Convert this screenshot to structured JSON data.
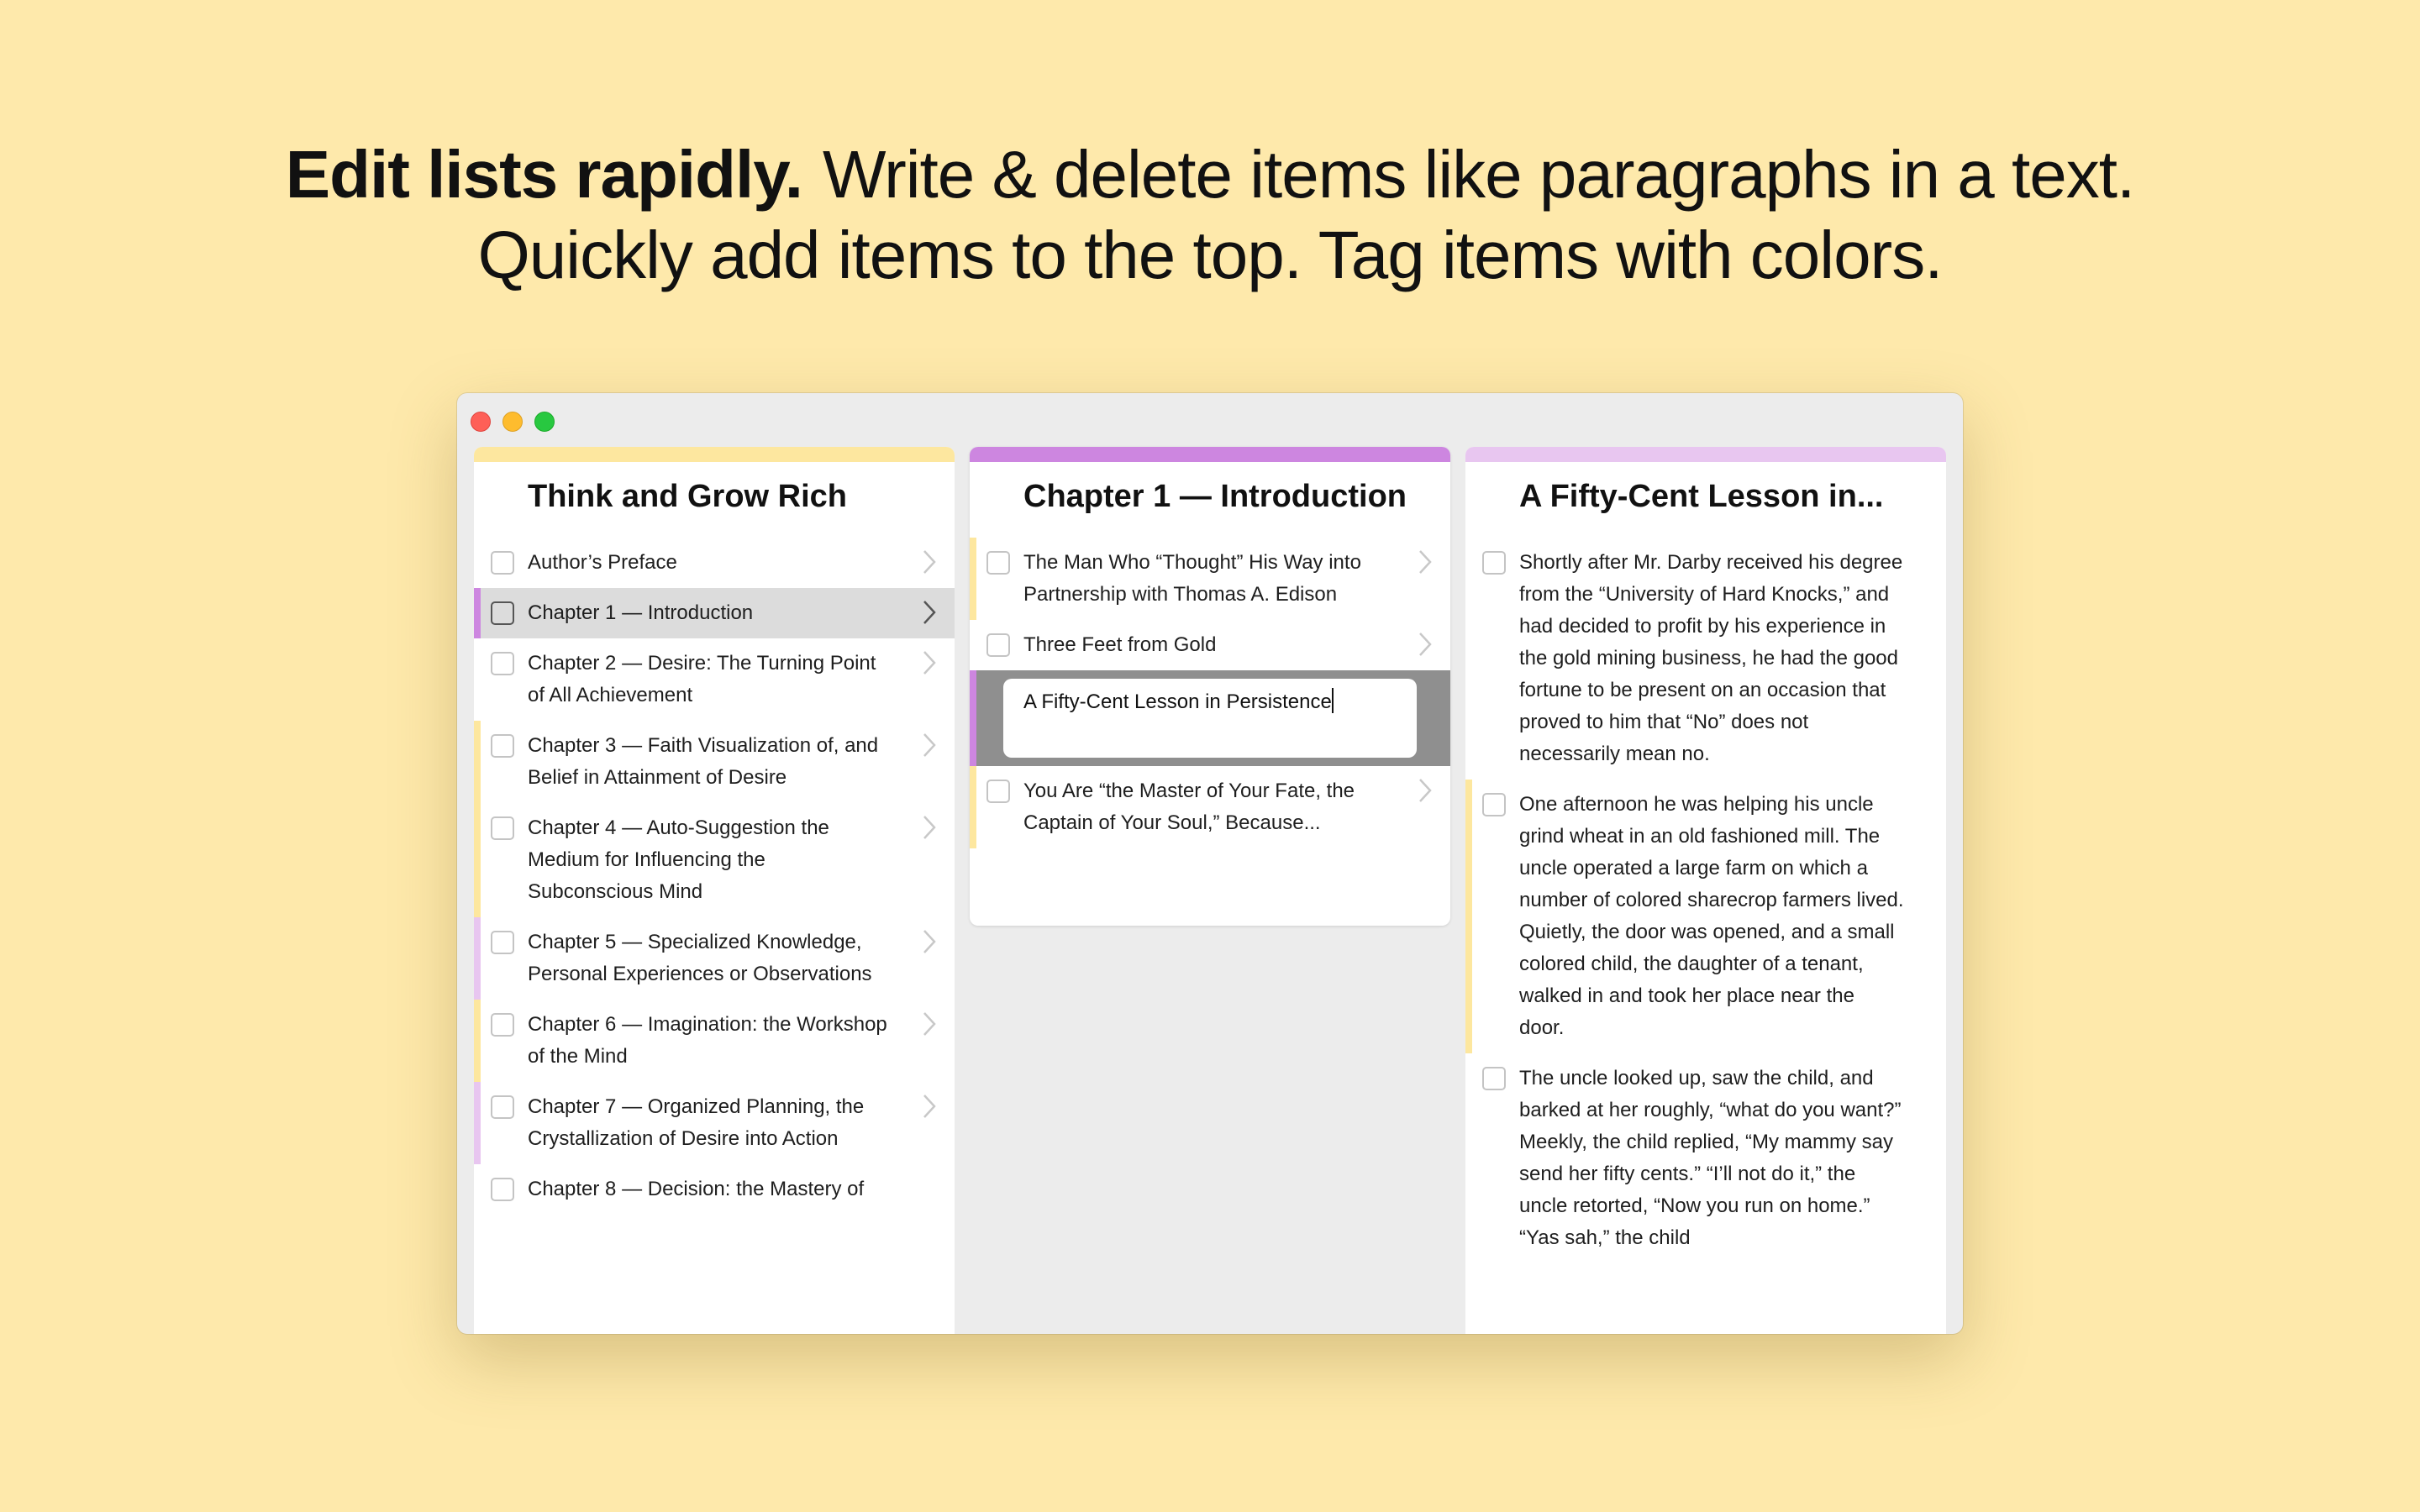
{
  "headline": {
    "bold": "Edit lists rapidly.",
    "rest": "Write & delete items like paragraphs in a text.",
    "line2": "Quickly add items to the top. Tag items with colors."
  },
  "colors": {
    "background": "#fee9ab",
    "tag_yellow": "#fde79f",
    "tag_purple": "#cd86e0",
    "tag_lavender": "#e8c6f0"
  },
  "columns": [
    {
      "title": "Think and Grow Rich",
      "items": [
        {
          "label": "Author’s Preface",
          "tag": "none"
        },
        {
          "label": "Chapter 1 — Introduction",
          "tag": "purple",
          "selected": true
        },
        {
          "label": "Chapter 2 — Desire: The Turning Point of All Achievement",
          "tag": "none"
        },
        {
          "label": "Chapter 3 — Faith Visualization of, and Belief in Attainment of Desire",
          "tag": "yellow"
        },
        {
          "label": "Chapter 4 — Auto-Suggestion the Medium for Influencing the Subconscious Mind",
          "tag": "yellow"
        },
        {
          "label": "Chapter 5 — Specialized Knowledge, Personal Experiences or Observations",
          "tag": "lavender"
        },
        {
          "label": "Chapter 6 — Imagination: the Workshop of the Mind",
          "tag": "yellow"
        },
        {
          "label": "Chapter 7 — Organized Planning, the Crystallization of Desire into Action",
          "tag": "lavender"
        },
        {
          "label": "Chapter 8 — Decision: the Mastery of",
          "tag": "none"
        }
      ]
    },
    {
      "title": "Chapter 1 — Introduction",
      "items": [
        {
          "label": "The Man Who “Thought” His Way into Partnership with Thomas A. Edison",
          "tag": "yellow"
        },
        {
          "label": "Three Feet from Gold",
          "tag": "none"
        },
        {
          "label": "You Are “the Master of Your Fate, the Captain of Your Soul,” Because...",
          "tag": "yellow"
        }
      ],
      "editing_value": "A Fifty-Cent Lesson in Persistence"
    },
    {
      "title": "A Fifty-Cent Lesson in...",
      "items": [
        {
          "label": "Shortly after Mr. Darby received his degree from the “University of Hard Knocks,” and had decided to profit by his experience in the gold mining business, he had the good fortune to be present on an occasion that proved to him that “No” does not necessarily mean no.",
          "tag": "none"
        },
        {
          "label": "One afternoon he was helping his uncle grind wheat in an old fashioned mill. The uncle operated a large farm on which a number of colored sharecrop farmers lived. Quietly, the door was opened, and a small colored child, the daughter of a tenant, walked in and took her place near the door.",
          "tag": "yellow"
        },
        {
          "label": "The uncle looked up, saw the child, and barked at her roughly, “what do you want?” Meekly, the child replied, “My mammy say send her fifty cents.” “I’ll not do it,” the uncle retorted, “Now you run on home.” “Yas sah,” the child",
          "tag": "none"
        }
      ]
    }
  ]
}
